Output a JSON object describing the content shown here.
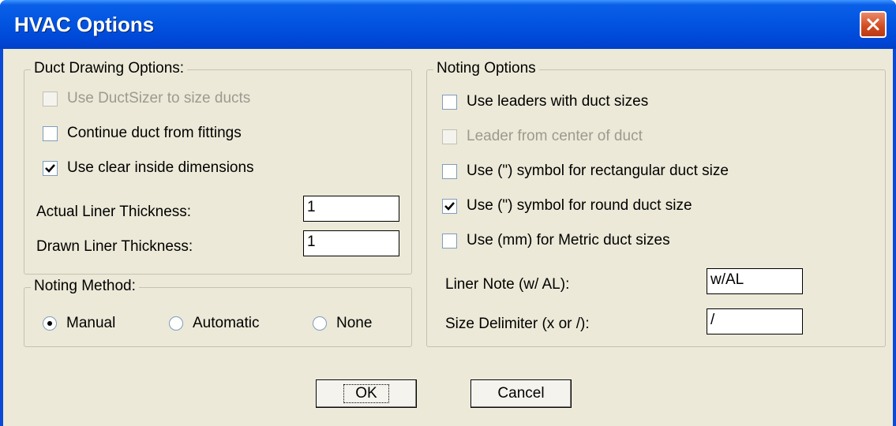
{
  "window": {
    "title": "HVAC Options",
    "close_icon": "close-icon"
  },
  "duct_drawing": {
    "legend": "Duct Drawing Options:",
    "options": [
      {
        "label": "Use DuctSizer to size ducts",
        "checked": false,
        "enabled": false
      },
      {
        "label": "Continue duct from fittings",
        "checked": false,
        "enabled": true
      },
      {
        "label": "Use clear inside dimensions",
        "checked": true,
        "enabled": true
      }
    ],
    "actual_liner_label": "Actual Liner Thickness:",
    "actual_liner_value": "1",
    "drawn_liner_label": "Drawn Liner Thickness:",
    "drawn_liner_value": "1"
  },
  "noting_method": {
    "legend": "Noting Method:",
    "options": [
      {
        "label": "Manual",
        "selected": true
      },
      {
        "label": "Automatic",
        "selected": false
      },
      {
        "label": "None",
        "selected": false
      }
    ]
  },
  "noting_options": {
    "legend": "Noting Options",
    "options": [
      {
        "label": "Use leaders with duct sizes",
        "checked": false,
        "enabled": true
      },
      {
        "label": "Leader from center of duct",
        "checked": false,
        "enabled": false
      },
      {
        "label": "Use (\") symbol for rectangular duct size",
        "checked": false,
        "enabled": true
      },
      {
        "label": "Use (\") symbol for round duct size",
        "checked": true,
        "enabled": true
      },
      {
        "label": "Use (mm) for Metric duct sizes",
        "checked": false,
        "enabled": true
      }
    ],
    "liner_note_label": "Liner Note (w/ AL):",
    "liner_note_value": "w/AL",
    "size_delimiter_label": "Size Delimiter (x or /):",
    "size_delimiter_value": "/"
  },
  "buttons": {
    "ok": "OK",
    "cancel": "Cancel"
  },
  "colors": {
    "titlebar": "#0255e0",
    "client": "#ece9d8",
    "close": "#d24a1e",
    "disabled_text": "#9c9a8f"
  }
}
